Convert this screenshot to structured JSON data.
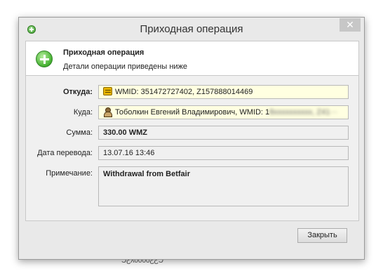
{
  "window": {
    "title": "Приходная операция",
    "close_glyph": "✕"
  },
  "header": {
    "title": "Приходная операция",
    "subtitle": "Детали операции приведены ниже",
    "icon": "plus-circle-icon"
  },
  "form": {
    "from": {
      "label": "Откуда:",
      "value": "WMID: 351472727402, Z157888014469",
      "icon": "purse-icon"
    },
    "to": {
      "label": "Куда:",
      "name": "Тоболкин Евгений Владимирович, WMID: 1",
      "hidden_part": "8xxxxxxxxxx, Z4",
      "tail": "1···",
      "icon": "person-icon"
    },
    "amount": {
      "label": "Сумма:",
      "value": "330.00 WMZ"
    },
    "date": {
      "label": "Дата перевода:",
      "value": "13.07.16 13:46"
    },
    "note": {
      "label": "Примечание:",
      "value": "Withdrawal from Betfair"
    }
  },
  "buttons": {
    "close_label": "Закрыть"
  },
  "underlay_text": "ƆƸʎ0000ƸƸƆ"
}
